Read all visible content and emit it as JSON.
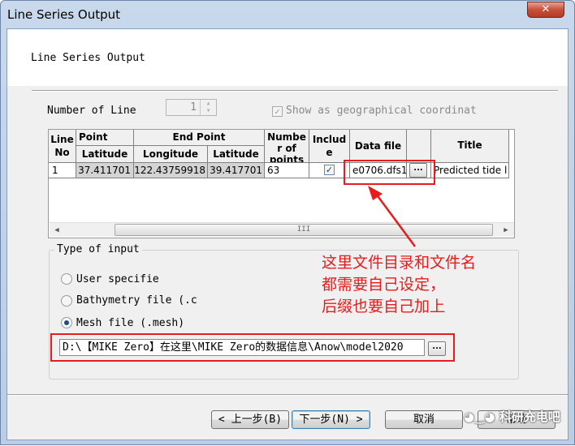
{
  "window": {
    "title": "Line Series Output",
    "close_glyph": "✕"
  },
  "page": {
    "heading": "Line Series Output"
  },
  "number_of_line": {
    "label": "Number of Line",
    "value": "1"
  },
  "show_geo": {
    "label": "Show as geographical coordinat",
    "checked": true
  },
  "table": {
    "headers": {
      "line_no": [
        "Line",
        "No"
      ],
      "start_point": "Point",
      "end_point": "End Point",
      "latitude": "Latitude",
      "longitude": "Longitude",
      "latitude2": "Latitude",
      "number_of_points": [
        "Numbe",
        "r of",
        "points"
      ],
      "include": [
        "Includ",
        "e"
      ],
      "data_file": "Data file",
      "title": "Title"
    },
    "rows": [
      {
        "line_no": "1",
        "start_latitude": "37.411701",
        "end_longitude": "122.43759918",
        "end_latitude": "39.417701",
        "num_points": "63",
        "include": true,
        "data_file": "e0706.dfs1",
        "browse": "...",
        "title": "Predicted tide l"
      }
    ],
    "scroll_grip": "III"
  },
  "type_of_input": {
    "title": "Type of input",
    "options": [
      {
        "label": "User specifie",
        "checked": false
      },
      {
        "label": "Bathymetry file (.c",
        "checked": false
      },
      {
        "label": "Mesh file (.mesh)",
        "checked": true
      }
    ],
    "path": "D:\\【MIKE Zero】在这里\\MIKE Zero的数据信息\\Anow\\model2020",
    "browse": "..."
  },
  "annotation": {
    "lines": [
      "这里文件目录和文件名",
      "都需要自己设定，",
      "后缀也要自己加上"
    ],
    "color": "#e81c1c"
  },
  "buttons": {
    "back": "< 上一步(B)",
    "next": "下一步(N) >",
    "cancel": "取消",
    "help": "帮助"
  },
  "watermark": "科研充电吧"
}
